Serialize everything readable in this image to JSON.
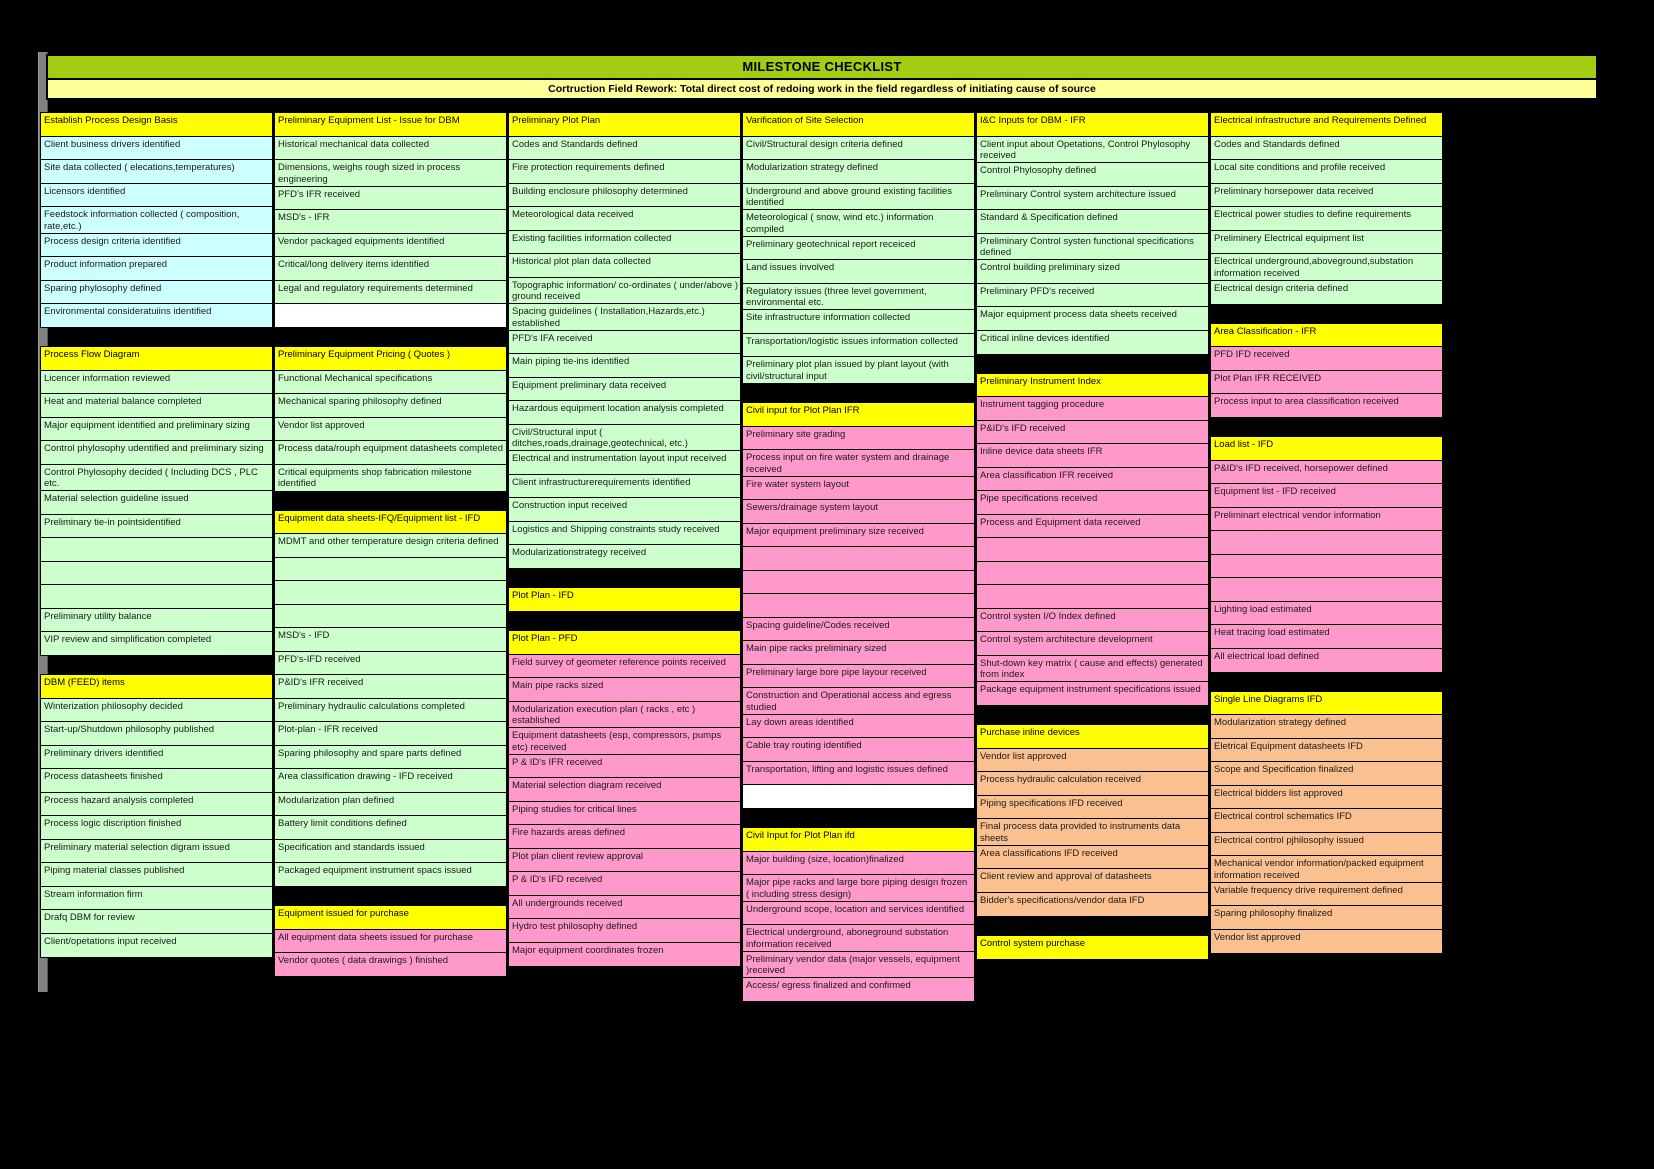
{
  "header": {
    "title": "MILESTONE CHECKLIST",
    "subtitle": "Cortruction Field Rework: Total direct cost of redoing work in the field regardless of initiating cause of source"
  },
  "colors": {
    "title_bar": "#a2cd12",
    "subtitle_bar": "#ffff99",
    "section_header": "#ffff00",
    "blue": "#ccffff",
    "green": "#ccffcc",
    "pink": "#ff99cc",
    "orange": "#fac090",
    "background": "#000000"
  },
  "columns": [
    {
      "id": "col-1",
      "groups": [
        {
          "header": "Establish Process Design Basis",
          "color": "blue",
          "items": [
            "Client business drivers identified",
            "Site data collected ( elecations,temperatures)",
            "Licensors identified",
            "Feedstock information collected ( composition, rate,etc.)",
            "Process design criteria identified",
            "Product information prepared",
            "Sparing phylosophy defined",
            "Environmental consideratuiins identified"
          ]
        },
        {
          "header": "Process Flow Diagram",
          "color": "green",
          "items": [
            "Licencer information reviewed",
            "Heat and material balance completed",
            "Major equipment identified and preliminary sizing",
            "Control phylosophy udentified and preliminary sizing",
            "Control Phylosophy decided ( Including DCS , PLC etc.",
            "Material selection guideline issued",
            "Preliminary tie-in pointsidentified",
            "",
            "",
            "",
            "Preliminary utility balance",
            "VIP review and simplification completed"
          ]
        },
        {
          "header": "DBM (FEED) items",
          "color": "green",
          "items": [
            "Winterization philosophy decided",
            "Start-up/Shutdown philosophy published",
            "Preliminary drivers identified",
            "Process datasheets finished",
            "Process hazard analysis completed",
            "Process logic discription finished",
            "Preliminary material selection  digram issued",
            "Piping material classes published",
            "Stream information firm",
            "Drafq DBM for review",
            "Client/opetations input received"
          ]
        }
      ]
    },
    {
      "id": "col-2",
      "groups": [
        {
          "header": "Preliminary Equipment List - Issue for DBM",
          "color": "green",
          "items": [
            "Historical mechanical data collected",
            "Dimensions, weighs rough sized in process engineering",
            "PFD's IFR received",
            "MSD's - IFR",
            "Vendor packaged equipments identified",
            "Critical/long delivery items identified",
            "Legal and regulatory requirements determined",
            ""
          ],
          "blank_white_indexes": [
            7
          ]
        },
        {
          "header": "Preliminary Equipment Pricing ( Quotes )",
          "color": "green",
          "items": [
            "Functional Mechanical specifications",
            "Mechanical sparing philosophy defined",
            "Vendor list approved",
            "Process data/rouph equipment datasheets completed",
            "Critical equipments shop fabrication milestone identified"
          ]
        },
        {
          "header": "Equipment data sheets-IFQ/Equipment list - IFD",
          "color": "green",
          "items": [
            "MDMT and other temperature design criteria defined",
            "",
            "",
            "",
            "MSD's - IFD",
            "PFD's-IFD received",
            "P&ID's IFR received",
            "Preliminary hydraulic calculations completed",
            "Plot-plan - IFR received",
            "Sparing philosophy and spare parts defined",
            "Area classification drawing - IFD received",
            "Modularization plan defined",
            "Battery limit conditions defined",
            "Specification and standards issued",
            "Packaged equipment instrument spacs issued"
          ]
        },
        {
          "header": "Equipment issued for purchase",
          "color": "pink",
          "items": [
            "All equipment data sheets issued for purchase",
            "Vendor quotes ( data drawings ) finished"
          ]
        }
      ]
    },
    {
      "id": "col-3",
      "groups": [
        {
          "header": "Preliminary Plot Plan",
          "color": "green",
          "items": [
            "Codes and Standards defined",
            "Fire protection requirements defined",
            "Building enclosure philosophy determined",
            "Meteorological data received",
            "Existing facilities information collected",
            "Historical plot plan data collected",
            "Topographic information/ co-ordinates ( under/above ) ground received",
            "Spacing guidelines ( Installation,Hazards,etc.) established",
            "PFD's IFA received",
            "Main piping tie-ins identified",
            "Equipment preliminary data received",
            "Hazardous equipment location analysis completed",
            "Civil/Structural input ( ditches,roads,drainage,geotechnical, etc.)",
            "Electrical and instrumentation layout input received",
            "Client infrastructurerequirements identified",
            "Construction input received",
            "Logistics and Shipping constraints study received",
            "Modularizationstrategy received"
          ]
        },
        {
          "header": "Plot Plan - IFD",
          "color": "green",
          "items": []
        },
        {
          "header": "Plot Plan - PFD",
          "color": "pink",
          "items": [
            "Field survey of geometer reference points received",
            "Main pipe racks sized",
            "Modularization execution plan  ( racks , etc ) established",
            "Equipment datasheets (esp, compressors, pumps etc) received",
            "P & ID's  IFR received",
            "Material selection diagram received",
            "Piping studies for critical lines",
            "Fire hazards areas defined",
            "Plot plan client review approval",
            "P & ID's IFD received",
            "All undergrounds received",
            "Hydro test philosophy defined",
            "Major equipment coordinates frozen"
          ]
        }
      ]
    },
    {
      "id": "col-4",
      "groups": [
        {
          "header": "Varification of Site Selection",
          "color": "green",
          "items": [
            "Civil/Structural design criteria defined",
            "Modularization strategy defined",
            "Underground and above ground existing facilities identified",
            "Meteorological ( snow, wind etc.) information compiled",
            "Preliminary geotechnical report receiced",
            "Land issues involved",
            "Regulatory issues (three level government, environmental etc.",
            "Site infrastructure information collected",
            "Transportation/logistic issues information collected",
            "Preliminary plot plan issued by plant layout (with civil/structural input"
          ]
        },
        {
          "header": "Civil input for Plot Plan IFR",
          "color": "pink",
          "items": [
            "Preliminary site grading",
            "Process input on fire water system and drainage received",
            "Fire water system layout",
            "Sewers/drainage system layout",
            "Major equipment preliminary size received",
            "",
            "",
            "",
            "Spacing guideline/Codes received",
            "Main pipe racks preliminary sized",
            "Preliminary large bore pipe layour received",
            "Construction and Operational access and egress studied",
            "Lay down areas identified",
            "Cable tray routing identified",
            "Transportation, lifting and logistic issues defined",
            ""
          ],
          "blank_white_indexes": [
            15
          ]
        },
        {
          "header": "Civil Input for Plot Plan ifd",
          "color": "pink",
          "items": [
            "Major building (size, location)finalized",
            "Major pipe racks and large bore piping design frozen ( including stress design)",
            "Underground scope, location and services identified",
            "Electrical underground, aboneground substation information received",
            "Preliminary vendor data (major vessels, equipment )received",
            "Access/ egress finalized and confirmed"
          ]
        }
      ]
    },
    {
      "id": "col-5",
      "groups": [
        {
          "header": "I&C Inputs for DBM - IFR",
          "color": "green",
          "items": [
            "Client input about Opetations, Control Phylosophy received",
            "Control Phylosophy defined",
            "Preliminary Control system architecture issued",
            "Standard & Specification defined",
            "Preliminary Control systen functional specifications defined",
            "Control building preliminary sized",
            "Preliminary PFD's received",
            "Major equipment process data sheets received",
            "Critical inline devices identified"
          ]
        },
        {
          "header": "Preliminary Instrument Index",
          "color": "pink",
          "items": [
            "Instrument tagging procedure",
            "P&ID's IFD received",
            "Inline device data sheets IFR",
            "Area classification IFR received",
            "Pipe specifications received",
            "Process and Equipment data received",
            "",
            "",
            "",
            "Control systen I/O Index defined",
            "Control system architecture development",
            "Shut-down key matrix ( cause and effects) generated from index",
            "Package equipment instrument specifications issued"
          ]
        },
        {
          "header": "Purchase inline devices",
          "color": "orange",
          "items": [
            "Vendor list approved",
            "Process hydraulic calculation received",
            "Piping specifications IFD received",
            "Final process data provided to instruments data sheets",
            "Area classifications IFD received",
            "Client review and approval of datasheets",
            "Bidder's specifications/vendor data IFD"
          ]
        },
        {
          "header": "Control system purchase",
          "color": "orange",
          "items": []
        }
      ]
    },
    {
      "id": "col-6",
      "groups": [
        {
          "header": "Electrical infrastructure and Requirements Defined",
          "color": "green",
          "items": [
            "Codes and Standards defined",
            "Local site conditions and profile received",
            "Preliminary horsepower data received",
            "Electrical power studies to define requirements",
            "Preliminery Electrical equipment list",
            "Electrical underground,aboveground,substation information received",
            "Electrical design criteria defined"
          ]
        },
        {
          "header": "Area Classification - IFR",
          "color": "pink",
          "items": [
            "PFD IFD received",
            "Plot Plan IFR RECEIVED",
            "Process input to area classification received"
          ]
        },
        {
          "header": "Load list - IFD",
          "color": "pink",
          "items": [
            "P&ID's IFD received, horsepower defined",
            "Equipment list - IFD received",
            "Preliminart electrical vendor information",
            "",
            "",
            "",
            "Lighting load estimated",
            "Heat tracing load estimated",
            "All electrical load defined"
          ]
        },
        {
          "header": "Single Line Diagrams IFD",
          "color": "orange",
          "items": [
            "Modularization strategy defined",
            "Eletrical Equipment datasheets IFD",
            "Scope and Specification finalized",
            "Electrical bidders list approved",
            "Electrical control schematics IFD",
            "Electrical control pjhilosophy issued",
            "Mechanical vendor information/packed equipment information received",
            "Variable frequency drive requirement defined",
            "Sparing philosophy finalized",
            "Vendor list approved"
          ]
        }
      ]
    }
  ]
}
